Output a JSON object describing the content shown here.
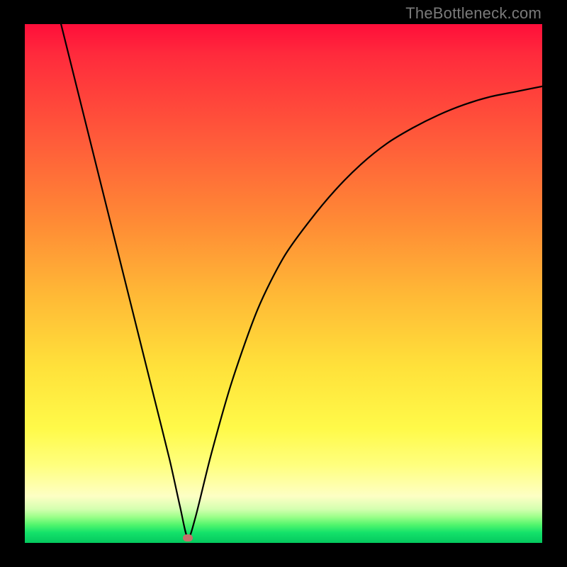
{
  "watermark": "TheBottleneck.com",
  "colors": {
    "frame": "#000000",
    "curve": "#000000",
    "minpoint": "#c76f6b"
  },
  "chart_data": {
    "type": "line",
    "title": "",
    "xlabel": "",
    "ylabel": "",
    "xlim": [
      0,
      100
    ],
    "ylim": [
      0,
      100
    ],
    "grid": false,
    "legend": false,
    "annotations": [
      "TheBottleneck.com"
    ],
    "series": [
      {
        "name": "bottleneck-curve",
        "x": [
          7,
          10,
          13,
          16,
          19,
          22,
          25,
          28,
          30,
          31.5,
          33,
          36,
          40,
          45,
          50,
          55,
          60,
          65,
          70,
          75,
          80,
          85,
          90,
          95,
          100
        ],
        "y": [
          100,
          88,
          76,
          64,
          52,
          40,
          28,
          16,
          7,
          1,
          5,
          17,
          31,
          45,
          55,
          62,
          68,
          73,
          77,
          80,
          82.5,
          84.5,
          86,
          87,
          88
        ]
      }
    ],
    "minimum": {
      "x": 31.5,
      "y": 1
    },
    "background_gradient": {
      "top": "#ff0e3a",
      "mid": "#ffe13a",
      "bottom": "#04c85e"
    }
  }
}
